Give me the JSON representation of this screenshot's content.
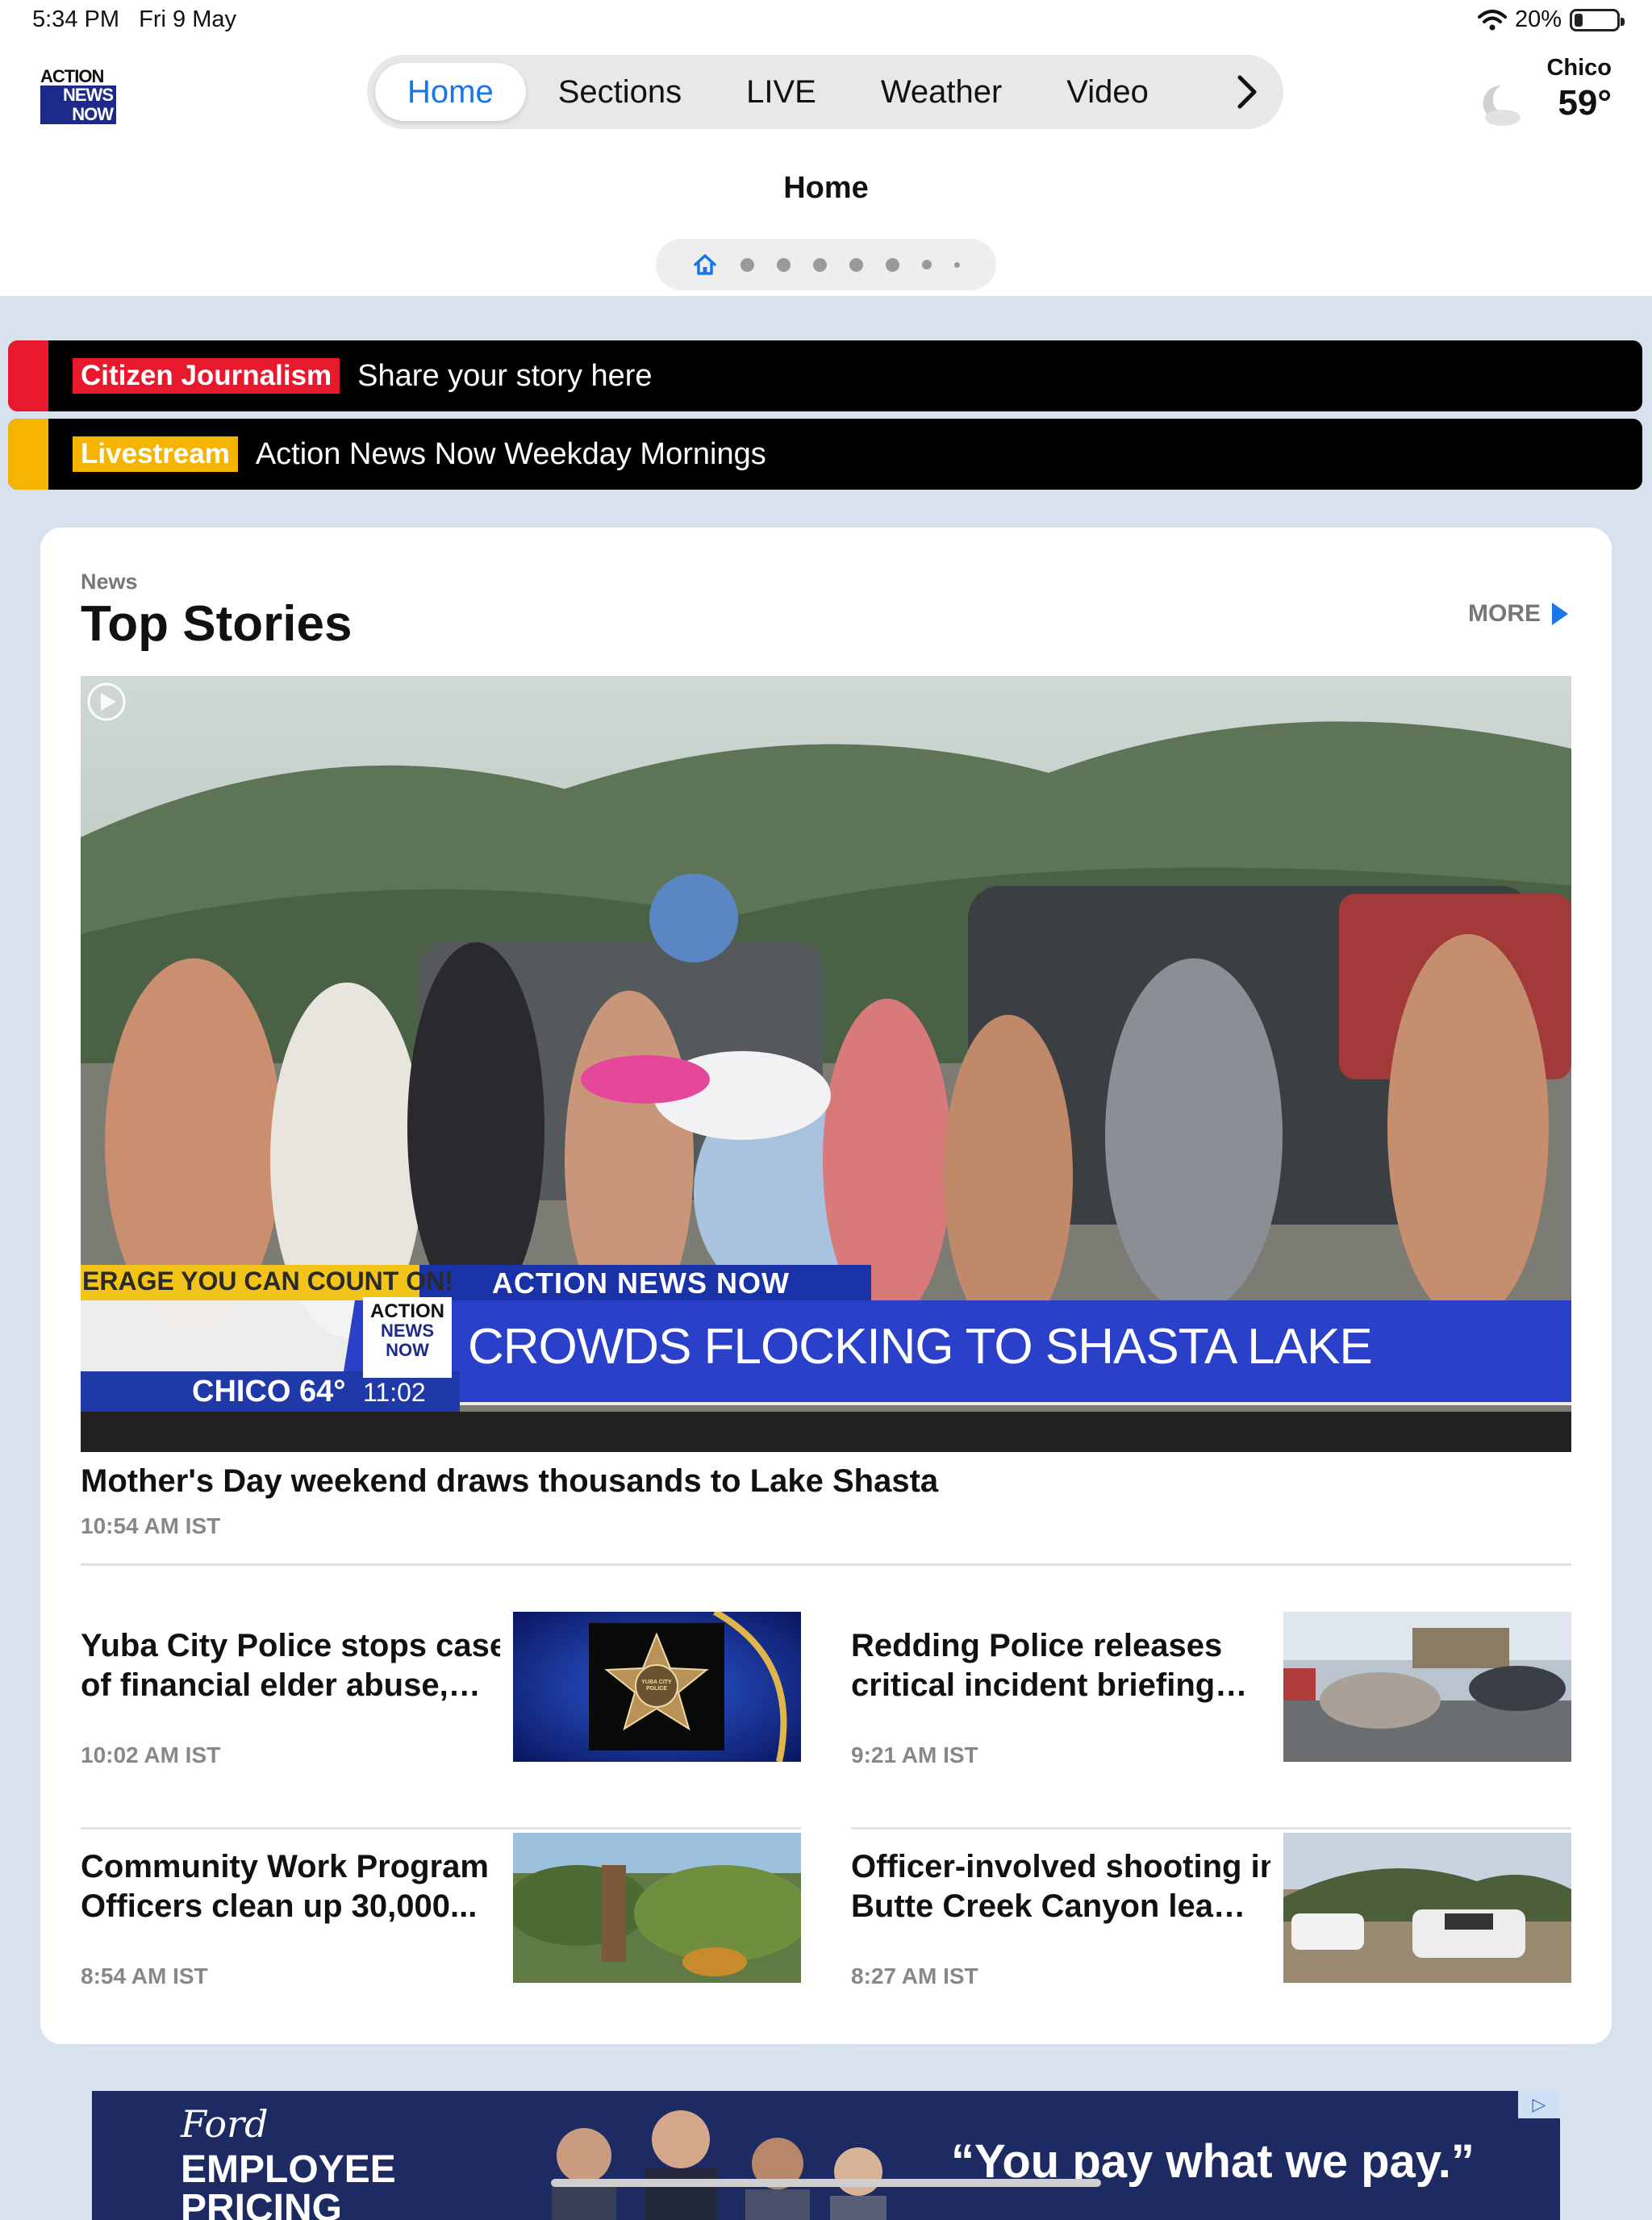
{
  "status": {
    "time": "5:34 PM",
    "date": "Fri 9 May",
    "battery": "20%",
    "battery_level": 0.2
  },
  "logo": {
    "line1": "ACTION",
    "line2": "NEWS",
    "line3": "NOW"
  },
  "nav": {
    "tabs": [
      "Home",
      "Sections",
      "LIVE",
      "Weather",
      "Video"
    ],
    "active": "Home",
    "next_icon": "chevron-right-icon"
  },
  "weather": {
    "city": "Chico",
    "temp": "59°",
    "icon": "moon-cloud-icon"
  },
  "page": {
    "title": "Home",
    "page_count": 8,
    "current_page": 1
  },
  "banners": [
    {
      "tag": "Citizen Journalism",
      "text": "Share your story here",
      "color": "#e8192c"
    },
    {
      "tag": "Livestream",
      "text": "Action News Now Weekday Mornings",
      "color": "#f5b400"
    }
  ],
  "section": {
    "kicker": "News",
    "title": "Top Stories",
    "more_label": "MORE"
  },
  "hero": {
    "title": "Mother's Day weekend draws thousands to Lake Shasta",
    "time": "10:54 AM IST",
    "overlay": {
      "ticker": "ERAGE YOU CAN COUNT ON!",
      "station": "ACTION NEWS NOW",
      "headline": "CROWDS FLOCKING TO SHASTA LAKE",
      "city_temp": "CHICO 64°",
      "clock": "11:02",
      "logo1": "ACTION",
      "logo2": "NEWS",
      "logo3": "NOW"
    }
  },
  "stories": [
    {
      "line1": "Yuba City Police stops case",
      "line2": "of financial elder abuse, t...",
      "time": "10:02 AM IST",
      "badge_text": "YUBA CITY POLICE"
    },
    {
      "line1": "Redding Police releases",
      "line2": "critical incident briefing v...",
      "time": "9:21 AM IST"
    },
    {
      "line1": "Community Work Program",
      "line2": "Officers clean up 30,000...",
      "time": "8:54 AM IST"
    },
    {
      "line1": "Officer-involved shooting in",
      "line2": "Butte Creek Canyon leave...",
      "time": "8:27 AM IST"
    }
  ],
  "ad": {
    "brand": "Ford",
    "line1": "EMPLOYEE",
    "line2": "PRICING",
    "quote": "“You pay what we pay.”",
    "badge": "▷"
  },
  "colors": {
    "accent": "#1976e6",
    "background": "#d8e1ee",
    "ad_bg": "#1e2b63"
  }
}
